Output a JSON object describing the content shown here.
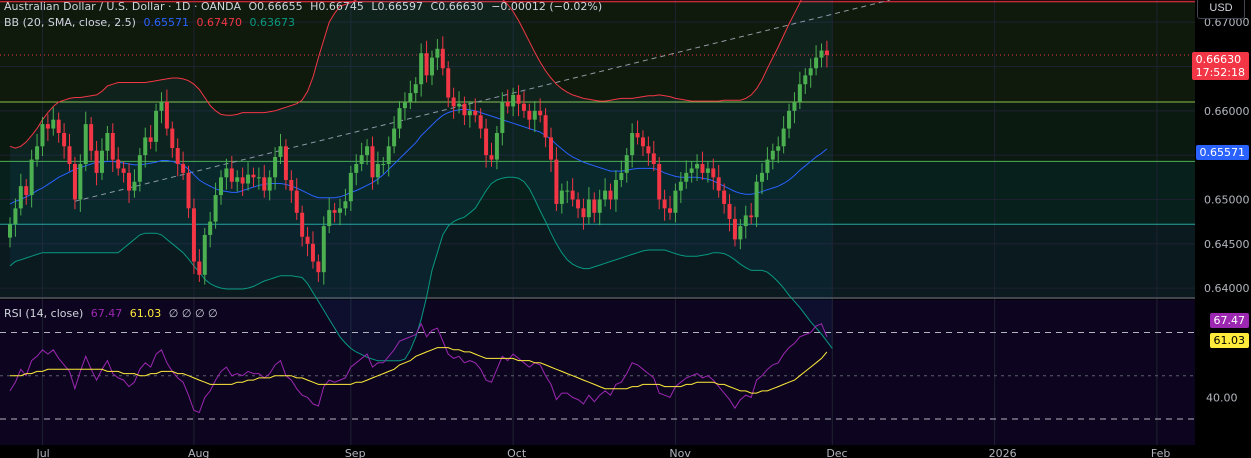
{
  "legend": {
    "symbol": "Australian Dollar / U.S. Dollar · 1D · OANDA",
    "open": "O0.66655",
    "high": "H0.66745",
    "low": "L0.66597",
    "close": "C0.66630",
    "change": "−0.00012 (−0.02%)",
    "bb_label": "BB (20, SMA, close, 2.5)",
    "bb_basis": "0.65571",
    "bb_upper": "0.67470",
    "bb_lower": "0.63673",
    "rsi_label": "RSI (14, close)",
    "rsi_value": "67.47",
    "rsi_ma": "61.03",
    "rsi_extra": "∅ ∅ ∅ ∅"
  },
  "currency": "USD",
  "price_tag": {
    "value": "0.66630",
    "countdown": "17:52:18"
  },
  "basis_tag": "0.65571",
  "rsi_tags": {
    "rsi": "67.47",
    "ma": "61.03"
  },
  "colors": {
    "up": "#4caf50",
    "down": "#f23645",
    "bb_upper": "#f23645",
    "bb_basis": "#2962ff",
    "bb_lower": "#089981",
    "rsi": "#9c27b0",
    "rsi_ma": "#ffeb3b",
    "price_tag": "#f23645",
    "basis_tag": "#2962ff"
  },
  "chart_data": [
    {
      "type": "candlestick",
      "ylim": [
        0.639,
        0.6725
      ],
      "y_ticks": [
        0.64,
        0.645,
        0.65,
        0.655,
        0.66,
        0.665,
        0.67
      ],
      "y_tick_labels": [
        "0.64000",
        "0.64500",
        "0.65000",
        "",
        "0.66000",
        "",
        "0.67000"
      ],
      "x_month_labels": [
        "Jul",
        "Aug",
        "Sep",
        "Oct",
        "Nov",
        "Dec",
        "2026",
        "Feb"
      ],
      "x_month_index": [
        6,
        34,
        63,
        93,
        123,
        152,
        182,
        212
      ],
      "horizontal_levels": [
        0.6723,
        0.6663,
        0.661,
        0.6543,
        0.6472
      ],
      "closes": [
        0.6472,
        0.649,
        0.6515,
        0.6505,
        0.6545,
        0.656,
        0.6585,
        0.658,
        0.659,
        0.6575,
        0.656,
        0.654,
        0.65,
        0.654,
        0.6585,
        0.6555,
        0.653,
        0.6555,
        0.6575,
        0.6545,
        0.6535,
        0.653,
        0.651,
        0.652,
        0.655,
        0.657,
        0.6565,
        0.66,
        0.661,
        0.658,
        0.6558,
        0.654,
        0.653,
        0.649,
        0.643,
        0.6415,
        0.646,
        0.6475,
        0.6505,
        0.6525,
        0.6535,
        0.652,
        0.6525,
        0.6518,
        0.6528,
        0.6525,
        0.6525,
        0.651,
        0.6525,
        0.6548,
        0.656,
        0.6522,
        0.651,
        0.6485,
        0.6458,
        0.645,
        0.643,
        0.6418,
        0.647,
        0.6488,
        0.6485,
        0.649,
        0.6498,
        0.653,
        0.654,
        0.655,
        0.656,
        0.6525,
        0.654,
        0.654,
        0.656,
        0.658,
        0.6603,
        0.661,
        0.662,
        0.663,
        0.6665,
        0.664,
        0.666,
        0.667,
        0.6648,
        0.6615,
        0.6605,
        0.6608,
        0.6595,
        0.66,
        0.6595,
        0.658,
        0.655,
        0.6545,
        0.6575,
        0.661,
        0.6605,
        0.6618,
        0.6608,
        0.66,
        0.659,
        0.66,
        0.6595,
        0.657,
        0.6545,
        0.6495,
        0.651,
        0.651,
        0.65,
        0.649,
        0.648,
        0.65,
        0.6485,
        0.65,
        0.651,
        0.65,
        0.6522,
        0.653,
        0.655,
        0.6575,
        0.657,
        0.656,
        0.6552,
        0.654,
        0.65,
        0.649,
        0.6485,
        0.651,
        0.652,
        0.653,
        0.6535,
        0.654,
        0.653,
        0.6535,
        0.6525,
        0.651,
        0.6495,
        0.6478,
        0.6455,
        0.647,
        0.6482,
        0.648,
        0.652,
        0.653,
        0.6545,
        0.6555,
        0.656,
        0.658,
        0.66,
        0.661,
        0.663,
        0.664,
        0.6648,
        0.666,
        0.6668,
        0.6663
      ],
      "series": [
        {
          "name": "BB Basis",
          "values": [
            0.6495,
            0.6498,
            0.65,
            0.6503,
            0.6506,
            0.651,
            0.6513,
            0.6517,
            0.6521,
            0.6525,
            0.6528,
            0.6531,
            0.6534,
            0.6536,
            0.6538,
            0.654,
            0.6542,
            0.6542,
            0.6543,
            0.6543,
            0.6542,
            0.6541,
            0.654,
            0.6539,
            0.6539,
            0.654,
            0.6541,
            0.6542,
            0.6544,
            0.6544,
            0.6543,
            0.6541,
            0.6539,
            0.6534,
            0.6528,
            0.6522,
            0.6518,
            0.6515,
            0.6512,
            0.651,
            0.6509,
            0.6508,
            0.6508,
            0.651,
            0.6512,
            0.6514,
            0.6516,
            0.6517,
            0.6518,
            0.6518,
            0.6518,
            0.6517,
            0.6515,
            0.6513,
            0.651,
            0.6507,
            0.6504,
            0.6502,
            0.6502,
            0.6502,
            0.6502,
            0.6503,
            0.6505,
            0.6508,
            0.651,
            0.6513,
            0.6516,
            0.6519,
            0.6523,
            0.6528,
            0.6534,
            0.654,
            0.6546,
            0.6552,
            0.6558,
            0.6564,
            0.6572,
            0.6578,
            0.6584,
            0.659,
            0.6595,
            0.6598,
            0.66,
            0.6601,
            0.6602,
            0.6601,
            0.66,
            0.6598,
            0.6596,
            0.6594,
            0.6592,
            0.659,
            0.6588,
            0.6586,
            0.6584,
            0.6582,
            0.658,
            0.6578,
            0.6576,
            0.6572,
            0.6568,
            0.6562,
            0.6557,
            0.6552,
            0.6548,
            0.6545,
            0.6542,
            0.654,
            0.6538,
            0.6536,
            0.6534,
            0.6532,
            0.6532,
            0.6532,
            0.6533,
            0.6534,
            0.6535,
            0.6535,
            0.6535,
            0.6535,
            0.6533,
            0.653,
            0.6528,
            0.6526,
            0.6525,
            0.6525,
            0.6525,
            0.6525,
            0.6524,
            0.6523,
            0.6521,
            0.6518,
            0.6515,
            0.6512,
            0.6509,
            0.6507,
            0.6506,
            0.6506,
            0.6507,
            0.6509,
            0.6511,
            0.6513,
            0.6515,
            0.6518,
            0.6522,
            0.6527,
            0.6533,
            0.6538,
            0.6543,
            0.6548,
            0.6552,
            0.6557
          ]
        },
        {
          "name": "BB Upper",
          "values": [
            0.656,
            0.6558,
            0.656,
            0.6565,
            0.6572,
            0.658,
            0.659,
            0.6598,
            0.6605,
            0.661,
            0.6612,
            0.6614,
            0.6615,
            0.6615,
            0.6616,
            0.6617,
            0.6618,
            0.6622,
            0.6628,
            0.663,
            0.6632,
            0.6632,
            0.6632,
            0.6632,
            0.6632,
            0.6632,
            0.6633,
            0.6634,
            0.6635,
            0.6636,
            0.6637,
            0.6637,
            0.6636,
            0.6634,
            0.663,
            0.6624,
            0.6615,
            0.6606,
            0.66,
            0.6596,
            0.6595,
            0.6595,
            0.6596,
            0.6598,
            0.6598,
            0.6598,
            0.6598,
            0.6598,
            0.6599,
            0.66,
            0.6602,
            0.6604,
            0.6606,
            0.6608,
            0.6612,
            0.6622,
            0.6638,
            0.666,
            0.668,
            0.67,
            0.671,
            0.6718,
            0.672,
            0.6722,
            0.6725,
            0.673,
            0.6733,
            0.6736,
            0.674,
            0.6748,
            0.6755,
            0.6762,
            0.677,
            0.6778,
            0.6782,
            0.6785,
            0.6786,
            0.6786,
            0.6786,
            0.6785,
            0.6783,
            0.678,
            0.6776,
            0.677,
            0.6762,
            0.6752,
            0.6745,
            0.674,
            0.6736,
            0.6733,
            0.673,
            0.6726,
            0.672,
            0.6712,
            0.6702,
            0.669,
            0.6678,
            0.6666,
            0.6655,
            0.6645,
            0.6637,
            0.663,
            0.6625,
            0.6621,
            0.6618,
            0.6616,
            0.6614,
            0.6613,
            0.6612,
            0.6611,
            0.6611,
            0.6612,
            0.6613,
            0.6614,
            0.6614,
            0.6614,
            0.6615,
            0.6616,
            0.6617,
            0.6617,
            0.6618,
            0.6617,
            0.6616,
            0.6614,
            0.6613,
            0.6612,
            0.6611,
            0.6611,
            0.6611,
            0.6611,
            0.6611,
            0.6611,
            0.6612,
            0.6612,
            0.6612,
            0.6612,
            0.6614,
            0.6618,
            0.6625,
            0.6635,
            0.6648,
            0.666,
            0.6672,
            0.6685,
            0.6698,
            0.671,
            0.6722,
            0.6734,
            0.6745,
            0.6755,
            0.6765,
            0.6775,
            0.6785
          ]
        },
        {
          "name": "BB Lower",
          "values": [
            0.6425,
            0.643,
            0.6432,
            0.6434,
            0.6436,
            0.6438,
            0.644,
            0.644,
            0.644,
            0.644,
            0.644,
            0.644,
            0.644,
            0.644,
            0.644,
            0.644,
            0.644,
            0.644,
            0.644,
            0.644,
            0.644,
            0.6445,
            0.645,
            0.6455,
            0.646,
            0.6462,
            0.6462,
            0.6462,
            0.646,
            0.6455,
            0.645,
            0.6445,
            0.644,
            0.6433,
            0.6425,
            0.6418,
            0.641,
            0.6405,
            0.6402,
            0.64,
            0.6399,
            0.6399,
            0.6399,
            0.6399,
            0.64,
            0.6402,
            0.6405,
            0.6408,
            0.641,
            0.6412,
            0.6414,
            0.6414,
            0.6414,
            0.6413,
            0.6412,
            0.6405,
            0.6395,
            0.6385,
            0.6375,
            0.6365,
            0.6355,
            0.6345,
            0.6338,
            0.6332,
            0.6328,
            0.6325,
            0.6322,
            0.632,
            0.6318,
            0.6318,
            0.6318,
            0.6318,
            0.6318,
            0.632,
            0.633,
            0.6345,
            0.6365,
            0.639,
            0.642,
            0.644,
            0.646,
            0.647,
            0.6475,
            0.6478,
            0.648,
            0.6485,
            0.649,
            0.65,
            0.651,
            0.6518,
            0.6522,
            0.6524,
            0.6525,
            0.6525,
            0.6524,
            0.652,
            0.6512,
            0.65,
            0.6487,
            0.6475,
            0.6462,
            0.645,
            0.644,
            0.6432,
            0.6427,
            0.6424,
            0.6422,
            0.6422,
            0.6424,
            0.6426,
            0.6428,
            0.643,
            0.6432,
            0.6434,
            0.6436,
            0.6438,
            0.644,
            0.6442,
            0.6443,
            0.6443,
            0.6443,
            0.6443,
            0.6441,
            0.6439,
            0.6437,
            0.6436,
            0.6436,
            0.6436,
            0.6437,
            0.6438,
            0.644,
            0.644,
            0.6439,
            0.6436,
            0.6432,
            0.6427,
            0.6423,
            0.642,
            0.642,
            0.642,
            0.6418,
            0.6413,
            0.6407,
            0.64,
            0.6392,
            0.6385,
            0.6378,
            0.637,
            0.6362,
            0.6355,
            0.6348,
            0.634,
            0.6332
          ]
        }
      ]
    },
    {
      "type": "line",
      "title": "RSI (14, close)",
      "ylim": [
        18,
        85
      ],
      "levels": [
        70,
        50,
        30
      ],
      "y_tick_labels": [
        "40.00"
      ],
      "series": [
        {
          "name": "RSI",
          "values": [
            43,
            47,
            53,
            50,
            57,
            59,
            62,
            60,
            62,
            58,
            55,
            52,
            44,
            52,
            59,
            53,
            48,
            53,
            57,
            51,
            49,
            48,
            45,
            47,
            53,
            56,
            54,
            60,
            62,
            56,
            52,
            49,
            47,
            41,
            34,
            33,
            40,
            43,
            48,
            52,
            54,
            50,
            51,
            50,
            52,
            51,
            51,
            49,
            51,
            55,
            57,
            50,
            48,
            44,
            41,
            40,
            37,
            36,
            45,
            48,
            47,
            48,
            49,
            54,
            56,
            58,
            60,
            54,
            56,
            56,
            59,
            62,
            66,
            67,
            68,
            69,
            74,
            68,
            71,
            72,
            66,
            60,
            58,
            59,
            56,
            57,
            56,
            53,
            48,
            47,
            53,
            59,
            57,
            60,
            58,
            56,
            54,
            56,
            55,
            50,
            46,
            39,
            42,
            42,
            40,
            39,
            37,
            41,
            38,
            41,
            43,
            41,
            46,
            47,
            51,
            56,
            55,
            53,
            51,
            49,
            42,
            41,
            40,
            45,
            47,
            49,
            50,
            51,
            49,
            50,
            48,
            45,
            42,
            39,
            35,
            39,
            41,
            40,
            48,
            50,
            53,
            55,
            56,
            60,
            63,
            65,
            68,
            69,
            70,
            73,
            74,
            68
          ]
        },
        {
          "name": "RSI MA",
          "values": [
            50,
            50,
            50,
            51,
            51,
            52,
            52,
            53,
            53,
            53,
            53,
            53,
            53,
            53,
            53,
            53,
            53,
            53,
            52,
            52,
            52,
            51,
            51,
            51,
            50,
            50,
            51,
            51,
            52,
            52,
            52,
            51,
            51,
            50,
            49,
            48,
            47,
            46,
            46,
            46,
            46,
            46,
            47,
            47,
            48,
            48,
            49,
            49,
            49,
            50,
            50,
            50,
            50,
            49,
            49,
            48,
            47,
            46,
            46,
            46,
            46,
            46,
            46,
            46,
            47,
            47,
            48,
            49,
            50,
            51,
            52,
            53,
            55,
            56,
            57,
            59,
            60,
            61,
            62,
            63,
            63,
            63,
            62,
            62,
            61,
            61,
            60,
            59,
            58,
            58,
            58,
            58,
            58,
            58,
            57,
            57,
            57,
            56,
            56,
            55,
            54,
            53,
            52,
            51,
            50,
            49,
            48,
            47,
            46,
            45,
            44,
            44,
            44,
            44,
            44,
            45,
            45,
            46,
            46,
            46,
            46,
            45,
            45,
            45,
            45,
            46,
            46,
            47,
            47,
            47,
            47,
            46,
            46,
            45,
            44,
            43,
            43,
            42,
            42,
            43,
            43,
            44,
            45,
            46,
            47,
            48,
            50,
            52,
            54,
            56,
            58,
            61
          ]
        }
      ]
    }
  ]
}
